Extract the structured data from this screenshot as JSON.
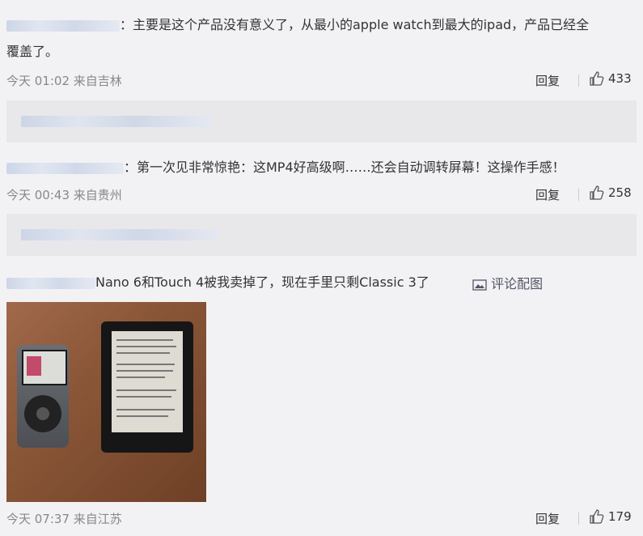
{
  "comments": [
    {
      "text": "：主要是这个产品没有意义了，从最小的apple watch到最大的ipad，产品已经全覆盖了。",
      "line1": "：主要是这个产品没有意义了，从最小的apple watch到最大的ipad，产品已经全",
      "line2": "覆盖了。",
      "time": "今天 01:02 来自吉林",
      "reply": "回复",
      "likes": "433"
    },
    {
      "text": "：第一次见非常惊艳：这MP4好高级啊……还会自动调转屏幕！这操作手感！",
      "time": "今天 00:43 来自贵州",
      "reply": "回复",
      "likes": "258"
    },
    {
      "text": "Nano 6和Touch 4被我卖掉了，现在手里只剩Classic 3了",
      "image_link": "评论配图",
      "time": "今天 07:37 来自江苏",
      "reply": "回复",
      "likes": "179"
    }
  ],
  "icons": {
    "like": "thumbs-up-icon",
    "image": "image-icon"
  },
  "colors": {
    "background": "#f2f2f5",
    "sub_box": "#e8e8eb",
    "meta_text": "#888888",
    "body_text": "#333333"
  }
}
